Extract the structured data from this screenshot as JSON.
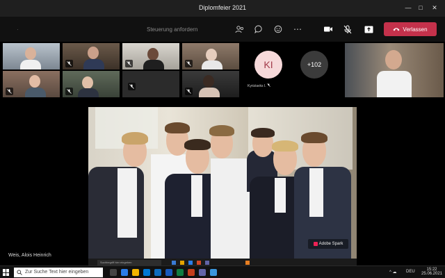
{
  "window": {
    "title": "Diplomfeier 2021"
  },
  "toolbar": {
    "request_control": "Steuerung anfordern",
    "leave_label": "Verlassen"
  },
  "participants": {
    "avatar_initials": "KI",
    "avatar_name": "Kyriziavks I.",
    "overflow_count": "+102"
  },
  "stage": {
    "presenter_name": "Weis, Alois Heinrich",
    "watermark": "Adobe Spark",
    "inner_search_placeholder": "Suchbegriff hier eingeben"
  },
  "taskbar": {
    "search_placeholder": "Zur Suche Text hier eingeben",
    "time": "15:22",
    "date": "25.06.2021",
    "lang": "DEU"
  },
  "colors": {
    "leave": "#c4314b",
    "active_speaker": "#7f85f5",
    "title_bar": "#1f1f1f"
  }
}
